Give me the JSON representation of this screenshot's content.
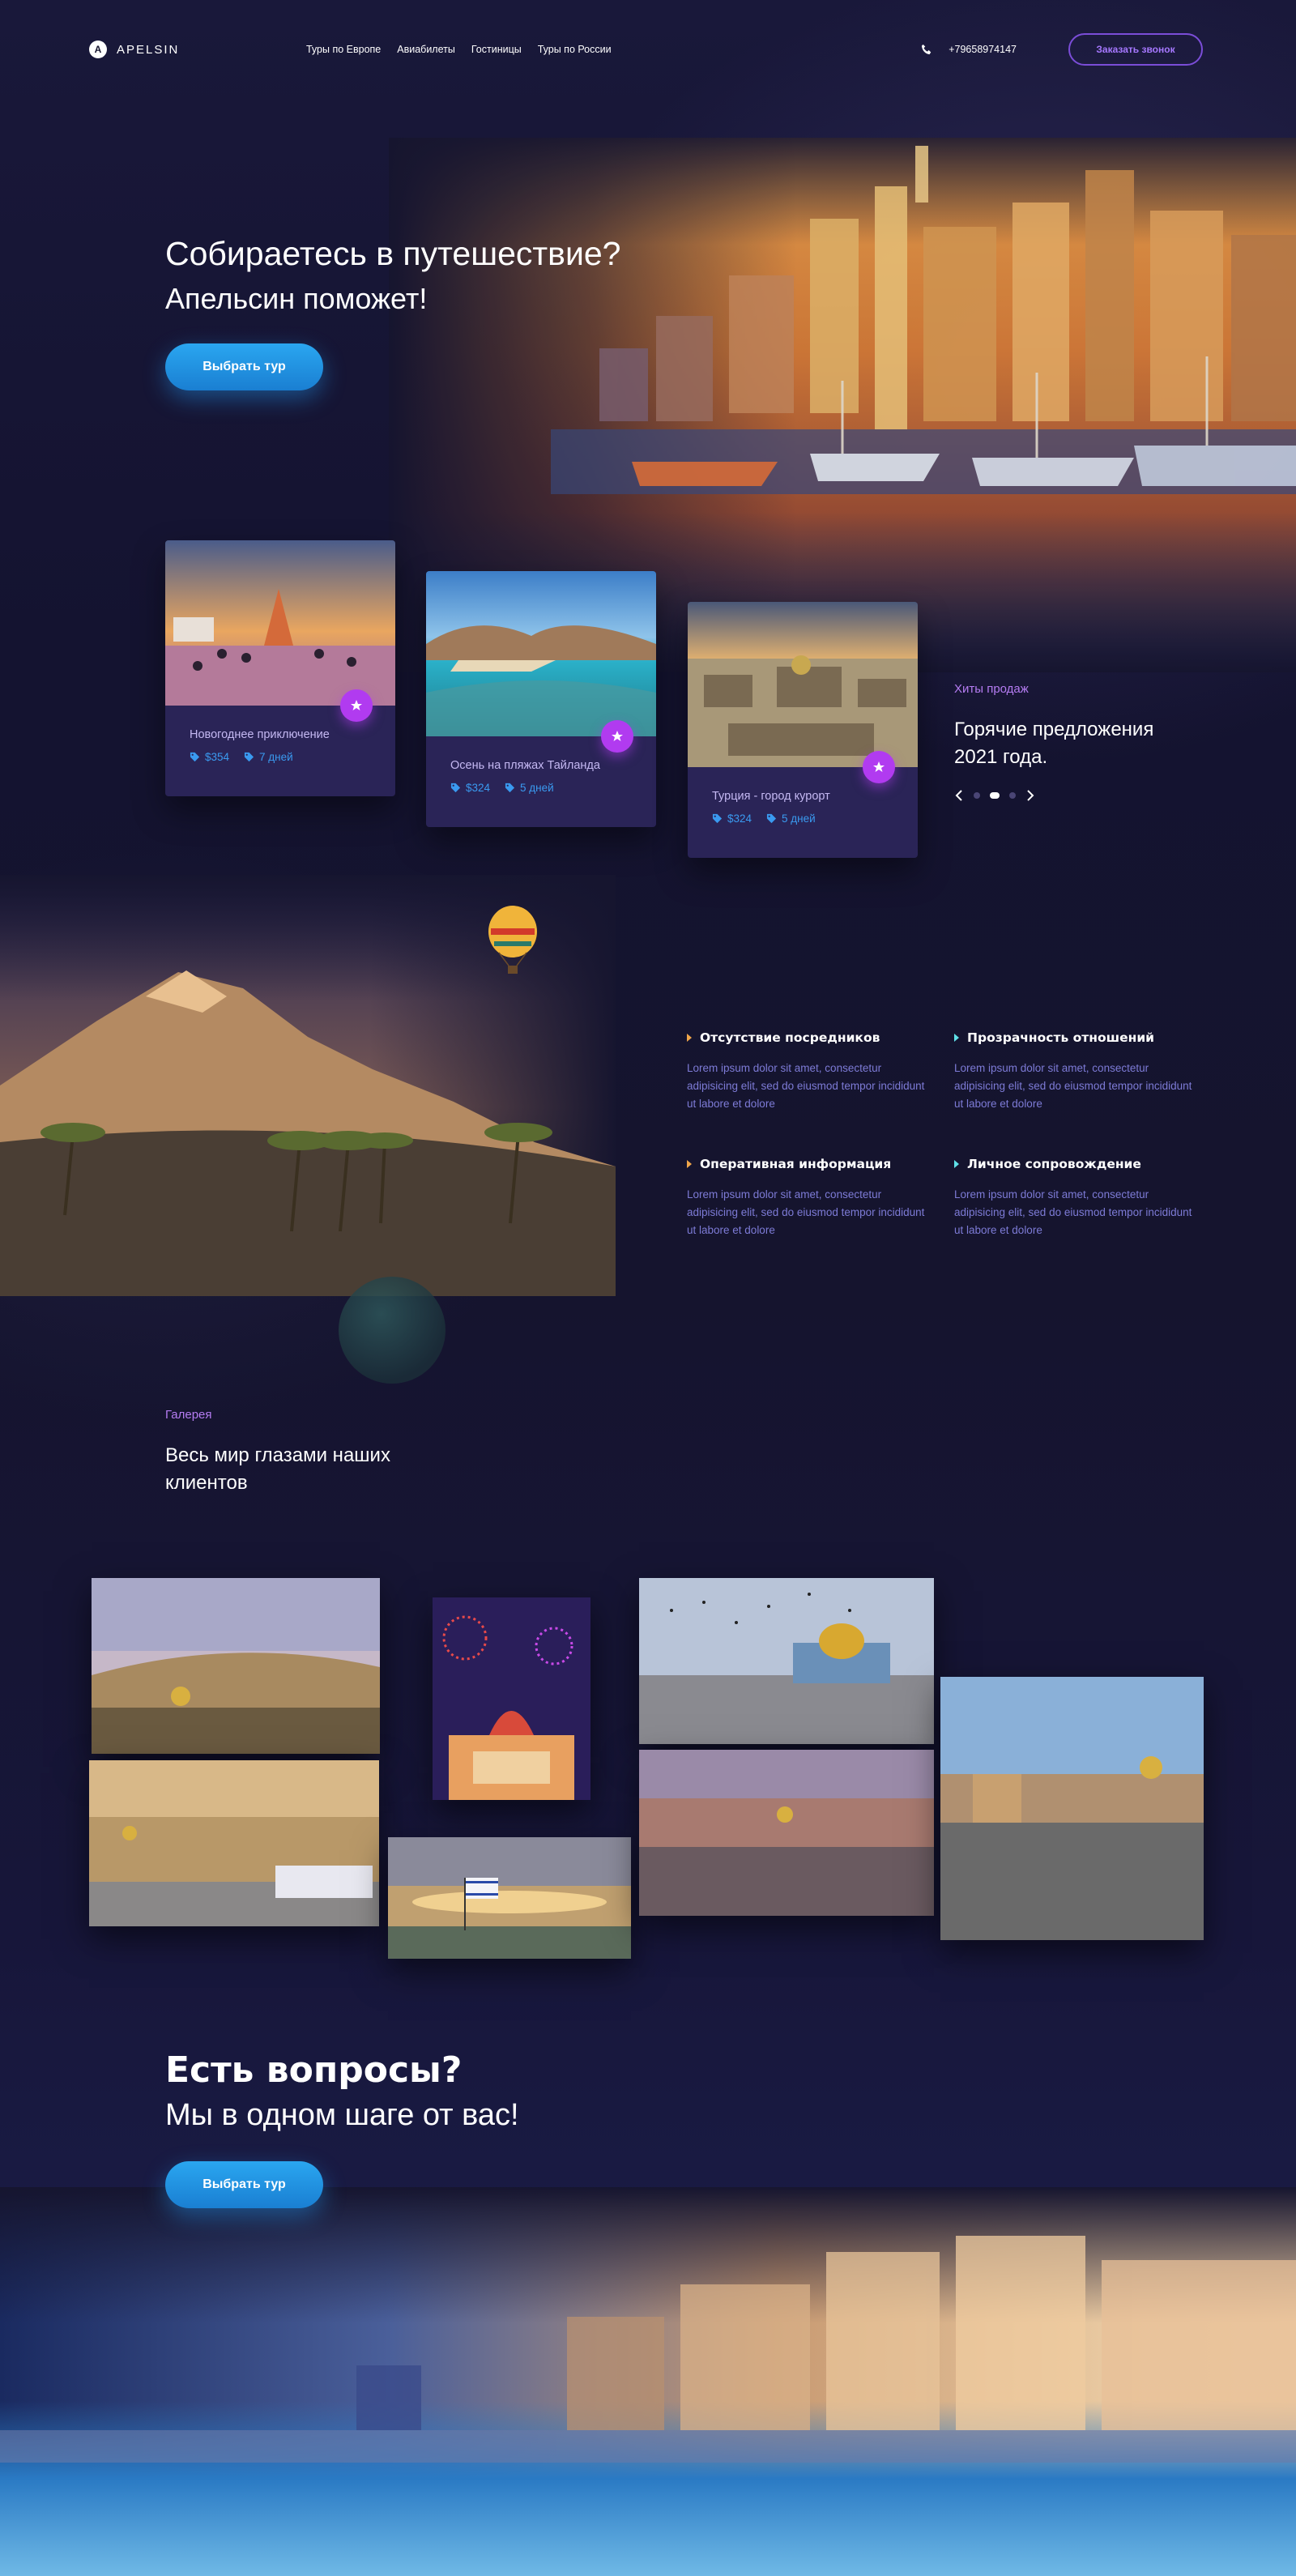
{
  "header": {
    "logo_text": "APELSIN",
    "logo_letter": "A",
    "nav": [
      "Туры по Европе",
      "Авиабилеты",
      "Гостиницы",
      "Туры по  России"
    ],
    "phone": "+79658974147",
    "cta": "Заказать звонок"
  },
  "hero": {
    "title": "Собираетесь в путешествие?",
    "subtitle": "Апельсин поможет!",
    "button": "Выбрать тур"
  },
  "tours": [
    {
      "title": "Новогоднее приключение",
      "price": "$354",
      "duration": "7 дней"
    },
    {
      "title": "Осень на пляжах Тайланда",
      "price": "$324",
      "duration": "5 дней"
    },
    {
      "title": "Турция - город курорт",
      "price": "$324",
      "duration": "5 дней"
    }
  ],
  "hits": {
    "label": "Хиты продаж",
    "title": "Горячие предложения 2021 года.",
    "active_slide": 2,
    "slides_total": 3
  },
  "features": [
    {
      "title": "Отсутствие посредников",
      "text": "Lorem ipsum dolor sit amet, consectetur adipisicing elit, sed do eiusmod tempor incididunt ut labore et dolore",
      "marker_color": "#f0a64a"
    },
    {
      "title": "Прозрачность отношений",
      "text": "Lorem ipsum dolor sit amet, consectetur adipisicing elit, sed do eiusmod tempor incididunt ut labore et dolore",
      "marker_color": "#5fe0e8"
    },
    {
      "title": "Оперативная информация",
      "text": "Lorem ipsum dolor sit amet, consectetur adipisicing elit, sed do eiusmod tempor incididunt ut labore et dolore",
      "marker_color": "#f0a64a"
    },
    {
      "title": "Личное сопровождение",
      "text": "Lorem ipsum dolor sit amet, consectetur adipisicing elit, sed do eiusmod tempor incididunt ut labore et dolore",
      "marker_color": "#5fe0e8"
    }
  ],
  "gallery": {
    "label": "Галерея",
    "title": " Весь мир  глазами наших клиентов"
  },
  "contact": {
    "title": "Есть вопросы?",
    "subtitle": "Мы в одном шаге от вас!",
    "button": "Выбрать тур"
  },
  "colors": {
    "accent_purple": "#b13bf0",
    "accent_blue": "#2aa6f0",
    "label_purple": "#b57cf2",
    "card_bg": "#2a2457",
    "page_bg": "#15132c"
  },
  "icons": [
    "phone-icon",
    "star-icon",
    "tag-icon",
    "chevron-left-icon",
    "chevron-right-icon"
  ]
}
